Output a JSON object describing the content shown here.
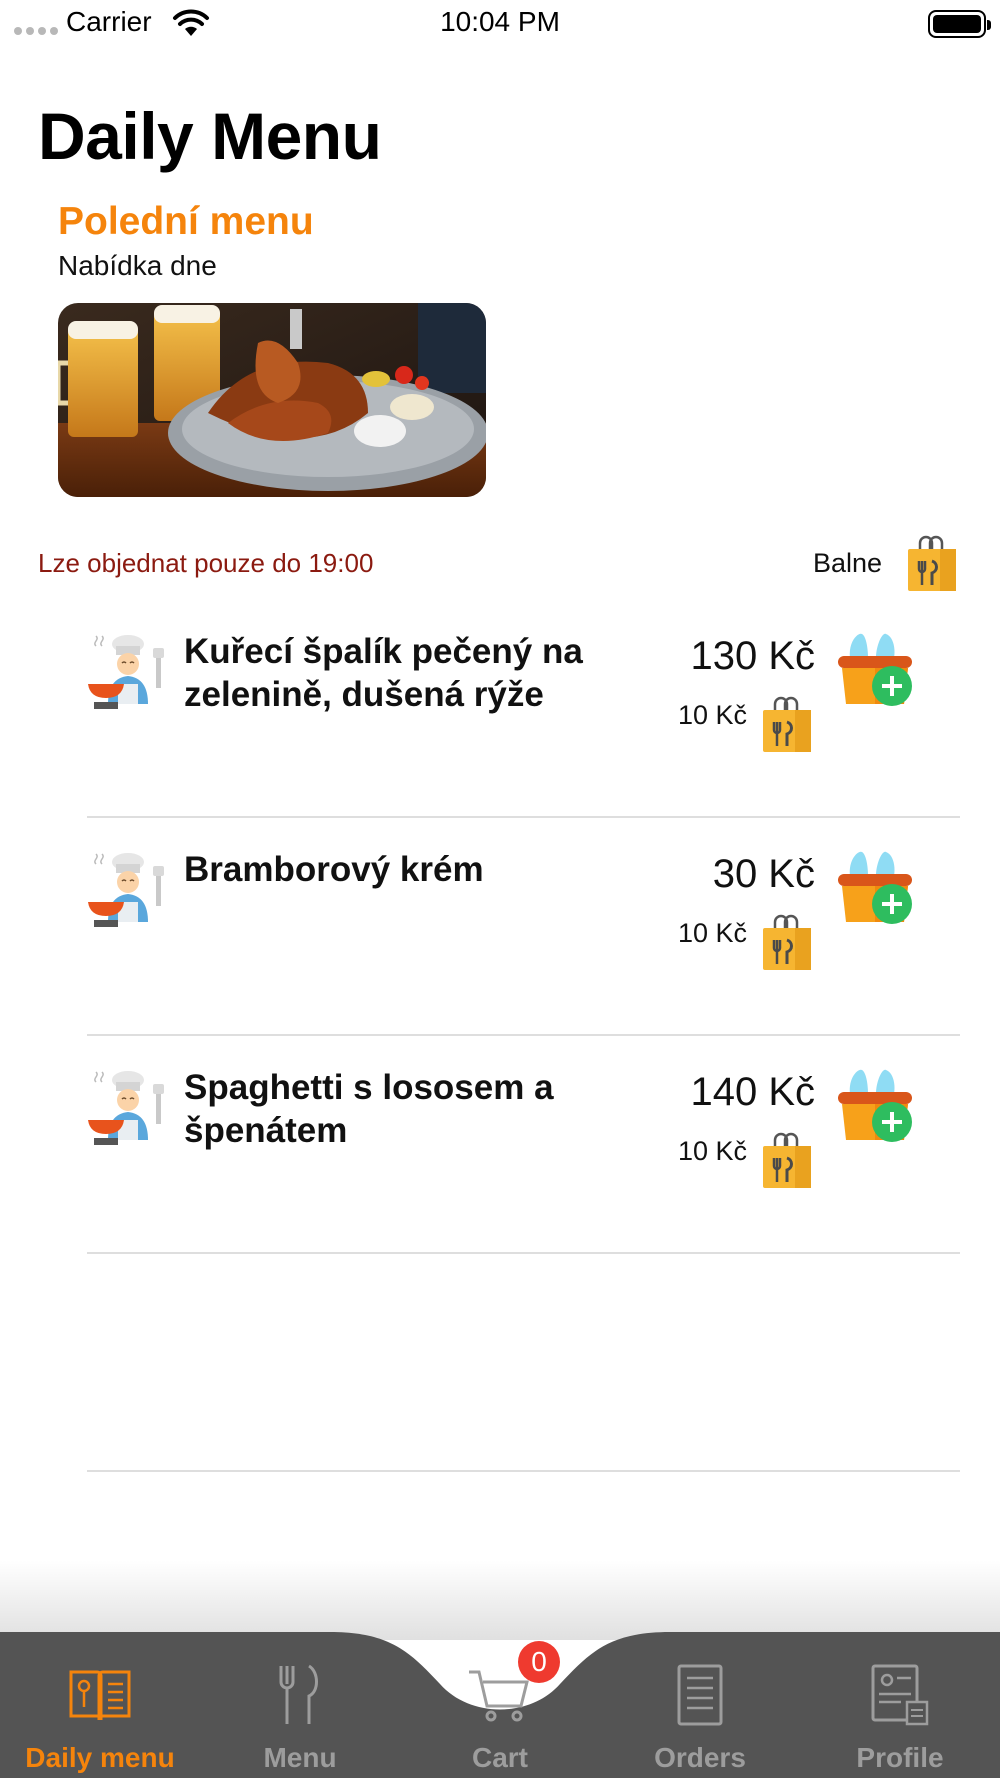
{
  "status_bar": {
    "carrier": "Carrier",
    "time": "10:04 PM"
  },
  "page": {
    "title": "Daily Menu",
    "section_title": "Polední menu",
    "section_subtitle": "Nabídka dne",
    "order_until": "Lze objednat pouze do 19:00",
    "packaging_label": "Balne"
  },
  "menu_items": [
    {
      "name": "Kuřecí špalík pečený na zelenině, dušená rýže",
      "price": "130 Kč",
      "packaging_price": "10 Kč"
    },
    {
      "name": "Bramborový krém",
      "price": "30 Kč",
      "packaging_price": "10 Kč"
    },
    {
      "name": "Spaghetti s lososem a špenátem",
      "price": "140 Kč",
      "packaging_price": "10 Kč"
    }
  ],
  "tabs": [
    {
      "label": "Daily menu",
      "icon": "open-menu-book-icon",
      "active": true
    },
    {
      "label": "Menu",
      "icon": "fork-knife-icon",
      "active": false
    },
    {
      "label": "Cart",
      "icon": "shopping-cart-icon",
      "active": false
    },
    {
      "label": "Orders",
      "icon": "order-list-icon",
      "active": false
    },
    {
      "label": "Profile",
      "icon": "profile-card-icon",
      "active": false
    }
  ],
  "cart_badge": "0",
  "colors": {
    "accent": "#f5840c",
    "warning_text": "#8b1a10",
    "tabbar": "#545454",
    "badge": "#ef3a2f"
  }
}
